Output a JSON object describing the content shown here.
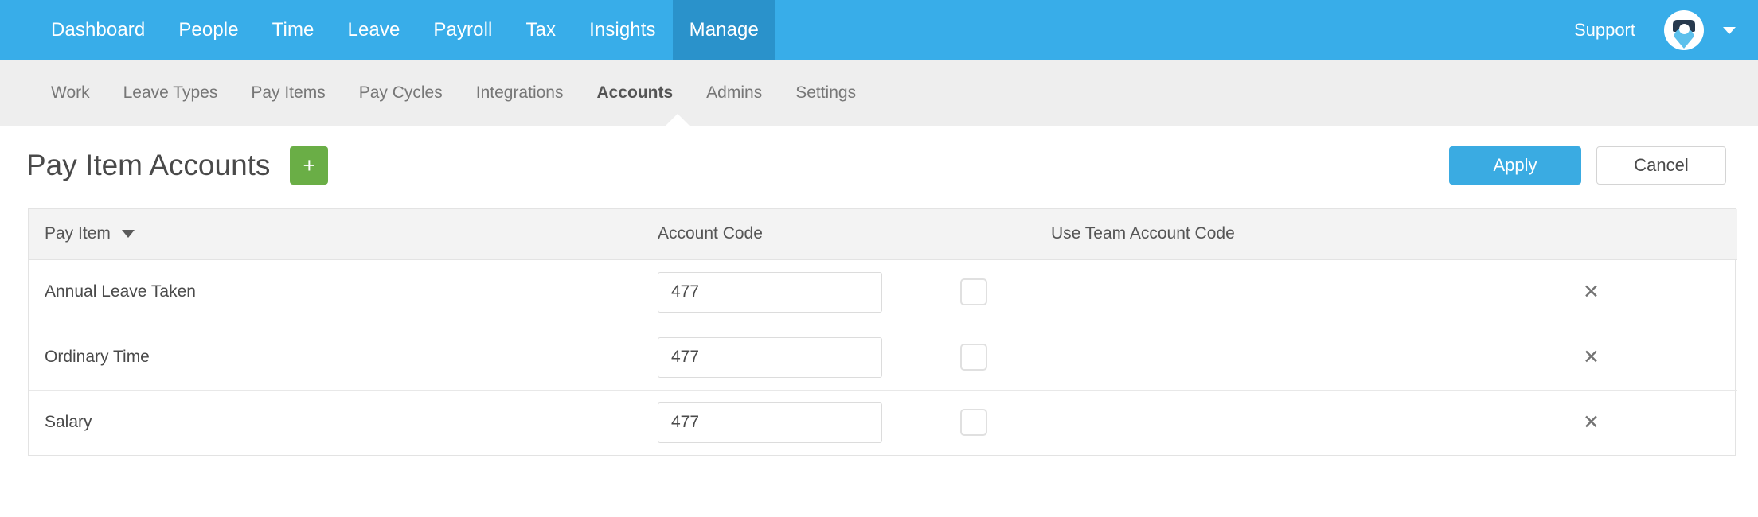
{
  "topnav": {
    "items": [
      {
        "label": "Dashboard",
        "active": false
      },
      {
        "label": "People",
        "active": false
      },
      {
        "label": "Time",
        "active": false
      },
      {
        "label": "Leave",
        "active": false
      },
      {
        "label": "Payroll",
        "active": false
      },
      {
        "label": "Tax",
        "active": false
      },
      {
        "label": "Insights",
        "active": false
      },
      {
        "label": "Manage",
        "active": true
      }
    ],
    "support_label": "Support",
    "avatar_icon": "user-avatar-icon",
    "caret_icon": "chevron-down-icon",
    "bar_color": "#38ade9",
    "active_color": "#2a92cb"
  },
  "subnav": {
    "items": [
      {
        "label": "Work",
        "active": false
      },
      {
        "label": "Leave Types",
        "active": false
      },
      {
        "label": "Pay Items",
        "active": false
      },
      {
        "label": "Pay Cycles",
        "active": false
      },
      {
        "label": "Integrations",
        "active": false
      },
      {
        "label": "Accounts",
        "active": true
      },
      {
        "label": "Admins",
        "active": false
      },
      {
        "label": "Settings",
        "active": false
      }
    ],
    "bar_color": "#eeeeee"
  },
  "page": {
    "title": "Pay Item Accounts",
    "add_label": "+",
    "add_color": "#6aae46",
    "apply_label": "Apply",
    "apply_color": "#3aabe2",
    "cancel_label": "Cancel"
  },
  "table": {
    "columns": [
      {
        "label": "Pay Item",
        "sort_icon": "sort-descending-caret"
      },
      {
        "label": "Account Code",
        "sort_icon": ""
      },
      {
        "label": "Use Team Account Code",
        "sort_icon": ""
      },
      {
        "label": "",
        "sort_icon": ""
      }
    ],
    "rows": [
      {
        "pay_item": "Annual Leave Taken",
        "account_code": "477",
        "account_code_placeholder": "",
        "use_team_account_code": false,
        "delete_icon": "close-icon",
        "delete_glyph": "✕"
      },
      {
        "pay_item": "Ordinary Time",
        "account_code": "477",
        "account_code_placeholder": "",
        "use_team_account_code": false,
        "delete_icon": "close-icon",
        "delete_glyph": "✕"
      },
      {
        "pay_item": "Salary",
        "account_code": "477",
        "account_code_placeholder": "",
        "use_team_account_code": false,
        "delete_icon": "close-icon",
        "delete_glyph": "✕"
      }
    ]
  }
}
